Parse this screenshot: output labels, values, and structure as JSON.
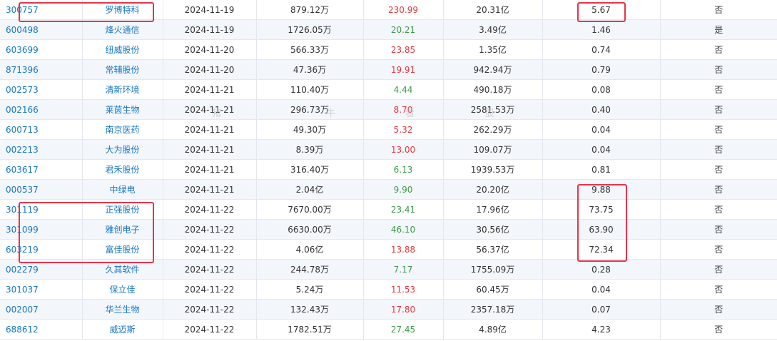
{
  "accent_link_color": "#1877c2",
  "highlight_color": "#e8334a",
  "rows": [
    {
      "code": "300757",
      "name": "罗博特科",
      "date": "2024-11-19",
      "amount": "879.12万",
      "pct": "230.99",
      "pct_color": "red",
      "cap": "20.31亿",
      "ratio": "5.67",
      "flag": "否"
    },
    {
      "code": "600498",
      "name": "烽火通信",
      "date": "2024-11-19",
      "amount": "1726.05万",
      "pct": "20.21",
      "pct_color": "green",
      "cap": "3.49亿",
      "ratio": "1.46",
      "flag": "是"
    },
    {
      "code": "603699",
      "name": "纽威股份",
      "date": "2024-11-20",
      "amount": "566.33万",
      "pct": "23.85",
      "pct_color": "red",
      "cap": "1.35亿",
      "ratio": "0.74",
      "flag": "否"
    },
    {
      "code": "871396",
      "name": "常辅股份",
      "date": "2024-11-20",
      "amount": "47.36万",
      "pct": "19.91",
      "pct_color": "red",
      "cap": "942.94万",
      "ratio": "0.79",
      "flag": "否"
    },
    {
      "code": "002573",
      "name": "清新环境",
      "date": "2024-11-21",
      "amount": "110.40万",
      "pct": "4.44",
      "pct_color": "green",
      "cap": "490.18万",
      "ratio": "0.08",
      "flag": "否"
    },
    {
      "code": "002166",
      "name": "莱茵生物",
      "date": "2024-11-21",
      "amount": "296.73万",
      "pct": "8.70",
      "pct_color": "red",
      "cap": "2581.53万",
      "ratio": "0.40",
      "flag": "否"
    },
    {
      "code": "600713",
      "name": "南京医药",
      "date": "2024-11-21",
      "amount": "49.30万",
      "pct": "5.32",
      "pct_color": "red",
      "cap": "262.29万",
      "ratio": "0.04",
      "flag": "否"
    },
    {
      "code": "002213",
      "name": "大为股份",
      "date": "2024-11-21",
      "amount": "8.39万",
      "pct": "13.00",
      "pct_color": "red",
      "cap": "109.07万",
      "ratio": "0.04",
      "flag": "否"
    },
    {
      "code": "603617",
      "name": "君禾股份",
      "date": "2024-11-21",
      "amount": "316.40万",
      "pct": "6.13",
      "pct_color": "green",
      "cap": "1939.53万",
      "ratio": "0.81",
      "flag": "否"
    },
    {
      "code": "000537",
      "name": "中绿电",
      "date": "2024-11-21",
      "amount": "2.04亿",
      "pct": "9.90",
      "pct_color": "green",
      "cap": "20.20亿",
      "ratio": "9.88",
      "flag": "否"
    },
    {
      "code": "301119",
      "name": "正强股份",
      "date": "2024-11-22",
      "amount": "7670.00万",
      "pct": "23.41",
      "pct_color": "green",
      "cap": "17.96亿",
      "ratio": "73.75",
      "flag": "否"
    },
    {
      "code": "301099",
      "name": "雅创电子",
      "date": "2024-11-22",
      "amount": "6630.00万",
      "pct": "46.10",
      "pct_color": "green",
      "cap": "30.56亿",
      "ratio": "63.90",
      "flag": "否"
    },
    {
      "code": "603219",
      "name": "富佳股份",
      "date": "2024-11-22",
      "amount": "4.06亿",
      "pct": "13.88",
      "pct_color": "red",
      "cap": "56.37亿",
      "ratio": "72.34",
      "flag": "否"
    },
    {
      "code": "002279",
      "name": "久其软件",
      "date": "2024-11-22",
      "amount": "244.78万",
      "pct": "7.17",
      "pct_color": "green",
      "cap": "1755.09万",
      "ratio": "0.28",
      "flag": "否"
    },
    {
      "code": "301037",
      "name": "保立佳",
      "date": "2024-11-22",
      "amount": "5.24万",
      "pct": "11.53",
      "pct_color": "red",
      "cap": "60.45万",
      "ratio": "0.04",
      "flag": "否"
    },
    {
      "code": "002007",
      "name": "华兰生物",
      "date": "2024-11-22",
      "amount": "132.43万",
      "pct": "17.80",
      "pct_color": "red",
      "cap": "2357.18万",
      "ratio": "0.07",
      "flag": "否"
    },
    {
      "code": "688612",
      "name": "威迈斯",
      "date": "2024-11-22",
      "amount": "1782.51万",
      "pct": "27.45",
      "pct_color": "green",
      "cap": "4.89亿",
      "ratio": "4.23",
      "flag": "否"
    }
  ],
  "watermark": [
    "猪",
    "牛",
    "看",
    "股"
  ]
}
